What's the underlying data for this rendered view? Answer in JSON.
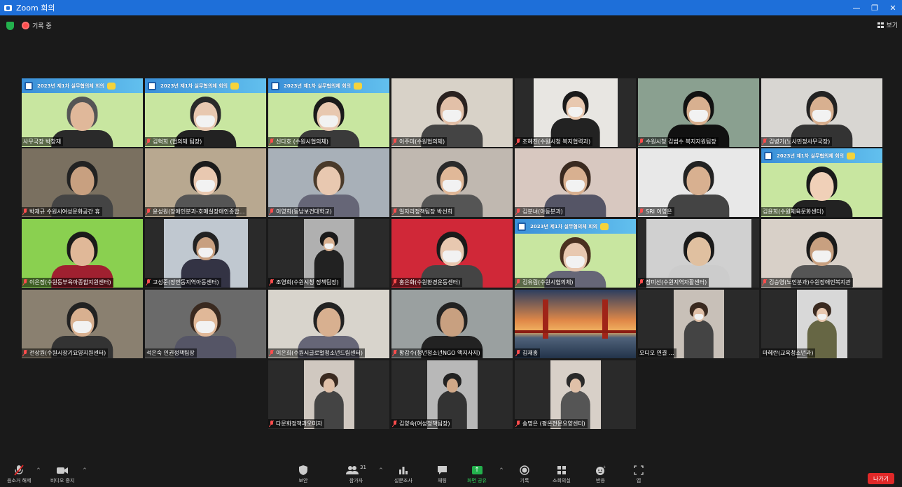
{
  "window": {
    "title": "Zoom 회의"
  },
  "window_controls": {
    "minimize": "—",
    "restore": "❐",
    "close": "✕"
  },
  "topbar": {
    "recording_label": "기록 중",
    "view_label": "보기"
  },
  "banner_text": "2023년 제1차 실무협의체 회의",
  "participants": [
    {
      "name": "사무국장 박창재",
      "muted": false
    },
    {
      "name": "김혁희 (협의체 팀장)",
      "muted": true
    },
    {
      "name": "신다호 (수원시협의체)",
      "muted": true
    },
    {
      "name": "이주미(수원협의체)",
      "muted": true
    },
    {
      "name": "조혜진(수원시청 복지협력과)",
      "muted": true
    },
    {
      "name": "수원시청 김범수 복지자원팀장",
      "muted": true
    },
    {
      "name": "김병기(노사민정사무국장)",
      "muted": true
    },
    {
      "name": "박재규 수원시여성문화공간 휴",
      "muted": true
    },
    {
      "name": "윤성원(장애인분과-호매실장애인종합...",
      "muted": true
    },
    {
      "name": "이영희(동남보건대학교)",
      "muted": true
    },
    {
      "name": "일자리정책팀장 박선희",
      "muted": true
    },
    {
      "name": "김분녀(아동분과)",
      "muted": true
    },
    {
      "name": "SRI 이영은",
      "muted": true
    },
    {
      "name": "김윤희(수원체육문화센터)",
      "muted": false
    },
    {
      "name": "이은정(수원동부육아종합지원센터)",
      "muted": true
    },
    {
      "name": "고성준(장안동지역아동센터)",
      "muted": true
    },
    {
      "name": "조영희(수원시청 정책팀장)",
      "muted": true
    },
    {
      "name": "홍은화(수원환경운동센터)",
      "muted": true
    },
    {
      "name": "김유림(수원시협의체)",
      "muted": true
    },
    {
      "name": "장미선(수원지역자활센터)",
      "muted": true
    },
    {
      "name": "김승영(노인분과)수원장애인복지관",
      "muted": true
    },
    {
      "name": "전상원(수원시장기요양지원센터)",
      "muted": true
    },
    {
      "name": "석은숙 인권정책팀장",
      "muted": false
    },
    {
      "name": "이은희(수원시글로벌청소년드림센터)",
      "muted": true
    },
    {
      "name": "황갑수(청년청소년NGO 액지사지)",
      "muted": true
    },
    {
      "name": "김재홍",
      "muted": true
    },
    {
      "name": "오디오 연결 ...",
      "muted": false
    },
    {
      "name": "마혜란(교육청소년과)",
      "muted": false
    },
    {
      "name": "다문화정책과오미자",
      "muted": true
    },
    {
      "name": "김양숙(여성정책팀장)",
      "muted": true
    },
    {
      "name": "송명은 (평온전문요양센터)",
      "muted": true
    }
  ],
  "toolbar": {
    "unmute": "음소거 해제",
    "stop_video": "비디오 중지",
    "security": "보안",
    "participants": "참가자",
    "participants_count": "31",
    "polls": "설문조사",
    "chat": "채팅",
    "share_screen": "화면 공유",
    "record": "기록",
    "breakout": "소회의실",
    "reactions": "반응",
    "apps": "앱",
    "leave": "나가기"
  },
  "colors": {
    "accent_green": "#2fd45a",
    "leave_red": "#e02828",
    "titlebar_blue": "#1e6fd9",
    "active_speaker": "#d8e24a"
  }
}
